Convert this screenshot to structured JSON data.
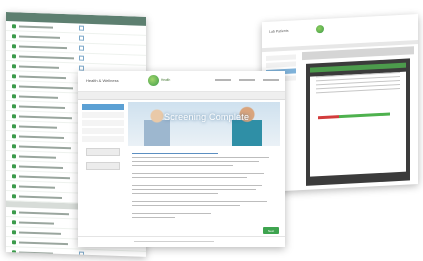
{
  "left_window": {
    "header": "",
    "rows": 24
  },
  "right_window": {
    "title": "Lab Patients",
    "nav_items": [
      "",
      "",
      "",
      ""
    ]
  },
  "front_window": {
    "title": "Health & Wellness",
    "logo_text": "Health",
    "banner_text": "Screening Complete",
    "next_label": "Next"
  },
  "colors": {
    "accent_green": "#3ea44f",
    "accent_blue": "#5ba0d4"
  }
}
